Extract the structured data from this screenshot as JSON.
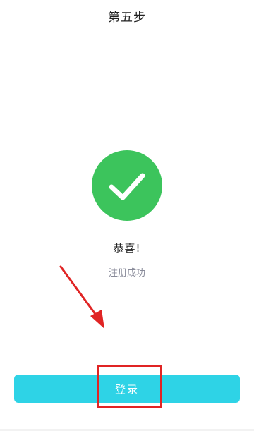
{
  "header": {
    "title": "第五步"
  },
  "result": {
    "status_icon": "check-icon",
    "success_color": "#3cc45c",
    "heading": "恭喜!",
    "message": "注册成功"
  },
  "actions": {
    "login_label": "登录",
    "login_color": "#2ed3e6"
  },
  "annotations": {
    "highlight_color": "#e02424",
    "arrow_icon": "arrow-icon"
  }
}
